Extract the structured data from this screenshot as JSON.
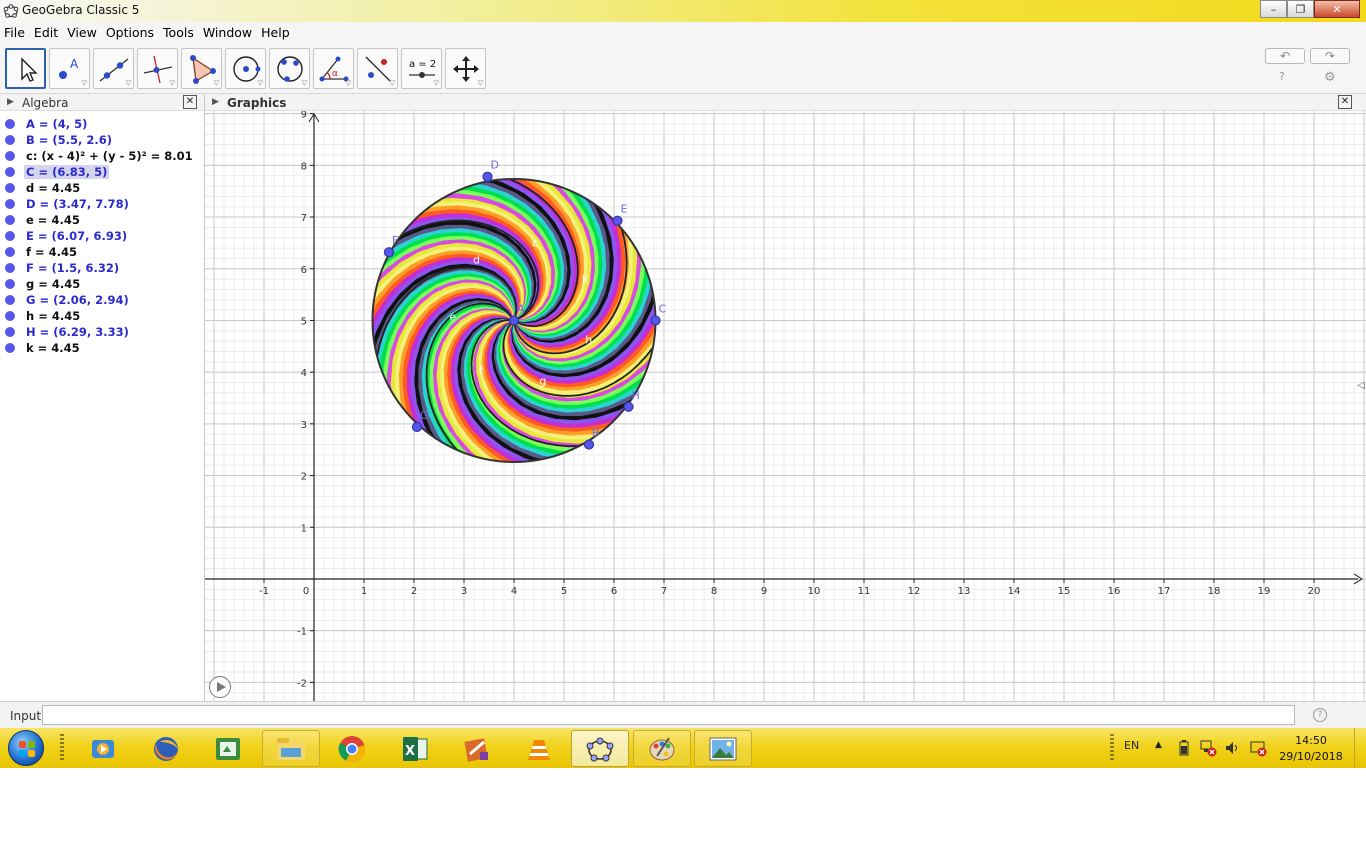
{
  "window": {
    "title": "GeoGebra Classic 5",
    "minimize": "–",
    "maximize": "❐",
    "close": "✕"
  },
  "menu": [
    "File",
    "Edit",
    "View",
    "Options",
    "Tools",
    "Window",
    "Help"
  ],
  "toolbar": {
    "tools": [
      "move-tool",
      "point-tool",
      "line-tool",
      "perpendicular-line-tool",
      "polygon-tool",
      "circle-center-point-tool",
      "circle-three-points-tool",
      "angle-tool",
      "reflect-tool",
      "slider-tool",
      "move-graphics-view-tool"
    ],
    "slider_label": "a = 2",
    "undo": "↶",
    "redo": "↷",
    "help": "?",
    "settings": "⚙"
  },
  "algebra": {
    "title": "Algebra",
    "items": [
      {
        "text": "A = (4, 5)",
        "kind": "point"
      },
      {
        "text": "B = (5.5, 2.6)",
        "kind": "point"
      },
      {
        "text": "c: (x - 4)² + (y - 5)² = 8.01",
        "kind": "dependent"
      },
      {
        "text": "C = (6.83, 5)",
        "kind": "point",
        "selected": true
      },
      {
        "text": "d = 4.45",
        "kind": "dependent"
      },
      {
        "text": "D = (3.47, 7.78)",
        "kind": "point"
      },
      {
        "text": "e = 4.45",
        "kind": "dependent"
      },
      {
        "text": "E = (6.07, 6.93)",
        "kind": "point"
      },
      {
        "text": "f = 4.45",
        "kind": "dependent"
      },
      {
        "text": "F = (1.5, 6.32)",
        "kind": "point"
      },
      {
        "text": "g = 4.45",
        "kind": "dependent"
      },
      {
        "text": "G = (2.06, 2.94)",
        "kind": "point"
      },
      {
        "text": "h = 4.45",
        "kind": "dependent"
      },
      {
        "text": "H = (6.29, 3.33)",
        "kind": "point"
      },
      {
        "text": "k = 4.45",
        "kind": "dependent"
      }
    ]
  },
  "graphics": {
    "title": "Graphics",
    "axes": {
      "x_ticks": [
        -1,
        0,
        1,
        2,
        3,
        4,
        5,
        6,
        7,
        8,
        9,
        10,
        11,
        12,
        13,
        14,
        15,
        16,
        17,
        18,
        19,
        20
      ],
      "y_ticks": [
        -2,
        -1,
        1,
        2,
        3,
        4,
        5,
        6,
        7,
        8,
        9
      ],
      "xlim": [
        -2.18,
        21.04
      ],
      "ylim": [
        -2.36,
        9.38
      ]
    },
    "circle": {
      "center": [
        4,
        5
      ],
      "radius": 2.83
    },
    "points": [
      {
        "name": "A",
        "x": 4,
        "y": 5
      },
      {
        "name": "B",
        "x": 5.5,
        "y": 2.6
      },
      {
        "name": "C",
        "x": 6.83,
        "y": 5
      },
      {
        "name": "D",
        "x": 3.47,
        "y": 7.78
      },
      {
        "name": "E",
        "x": 6.07,
        "y": 6.93
      },
      {
        "name": "F",
        "x": 1.5,
        "y": 6.32
      },
      {
        "name": "G",
        "x": 2.06,
        "y": 2.94
      },
      {
        "name": "H",
        "x": 6.29,
        "y": 3.33
      }
    ],
    "arc_labels": [
      "c",
      "d",
      "e",
      "f",
      "g",
      "h",
      "k"
    ],
    "colors": {
      "point": "#5457e8",
      "point_stroke": "#3434a8",
      "label": "#6c6ce0",
      "axis": "#222222",
      "grid_major": "#c9c9c9",
      "grid_minor": "#ececec"
    },
    "rainbow": [
      "#e8e83a",
      "#f2f27a",
      "#ff9f2a",
      "#ff5a1f",
      "#c42ed6",
      "#8a56f0",
      "#111111",
      "#5a5a8a",
      "#2ad4d4",
      "#00e04a",
      "#7aff5a",
      "#d84ae0"
    ]
  },
  "input": {
    "label": "Input:",
    "value": "",
    "help": "?"
  },
  "taskbar": {
    "apps": [
      "media-player-icon",
      "firefox-icon",
      "file-manager-icon",
      "explorer-icon",
      "chrome-icon",
      "excel-icon",
      "paint-tool-icon",
      "vlc-icon",
      "geogebra-icon",
      "paint-icon",
      "photos-icon"
    ],
    "language": "EN",
    "time": "14:50",
    "date": "29/10/2018"
  }
}
